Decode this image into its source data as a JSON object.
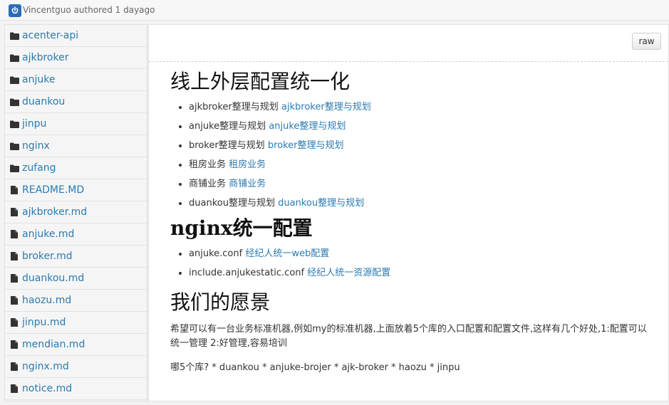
{
  "header": {
    "author_line": "Vincentguo authored 1 dayago"
  },
  "toolbar": {
    "raw_label": "raw"
  },
  "sidebar": {
    "items": [
      {
        "label": "acenter-api",
        "icon": "folder-icon"
      },
      {
        "label": "ajkbroker",
        "icon": "folder-icon"
      },
      {
        "label": "anjuke",
        "icon": "folder-icon"
      },
      {
        "label": "duankou",
        "icon": "folder-icon"
      },
      {
        "label": "jinpu",
        "icon": "folder-icon"
      },
      {
        "label": "nginx",
        "icon": "folder-icon"
      },
      {
        "label": "zufang",
        "icon": "folder-icon"
      },
      {
        "label": "README.MD",
        "icon": "file-icon"
      },
      {
        "label": "ajkbroker.md",
        "icon": "file-icon"
      },
      {
        "label": "anjuke.md",
        "icon": "file-icon"
      },
      {
        "label": "broker.md",
        "icon": "file-icon"
      },
      {
        "label": "duankou.md",
        "icon": "file-icon"
      },
      {
        "label": "haozu.md",
        "icon": "file-icon"
      },
      {
        "label": "jinpu.md",
        "icon": "file-icon"
      },
      {
        "label": "mendian.md",
        "icon": "file-icon"
      },
      {
        "label": "nginx.md",
        "icon": "file-icon"
      },
      {
        "label": "notice.md",
        "icon": "file-icon"
      }
    ]
  },
  "doc": {
    "h1": "线上外层配置统一化",
    "list1": [
      {
        "text": "ajkbroker整理与规划",
        "link": "ajkbroker整理与规划"
      },
      {
        "text": "anjuke整理与规划",
        "link": "anjuke整理与规划"
      },
      {
        "text": "broker整理与规划",
        "link": "broker整理与规划"
      },
      {
        "text": "租房业务",
        "link": "租房业务"
      },
      {
        "text": "商铺业务",
        "link": "商铺业务"
      },
      {
        "text": "duankou整理与规划",
        "link": "duankou整理与规划"
      }
    ],
    "h2": "nginx统一配置",
    "list2": [
      {
        "text": "anjuke.conf",
        "link": "经纪人统一web配置"
      },
      {
        "text": "include.anjukestatic.conf",
        "link": "经纪人统一资源配置"
      }
    ],
    "h3": "我们的愿景",
    "para": "希望可以有一台业务标准机器,例如my的标准机器,上面放着5个库的入口配置和配置文件,这样有几个好处,1:配置可以统一管理 2:好管理,容易培训",
    "question": "哪5个库? * duankou * anjuke-brojer * ajk-broker * haozu * jinpu"
  },
  "colors": {
    "link": "#2a7ab0",
    "logo": "#2a6db5"
  }
}
